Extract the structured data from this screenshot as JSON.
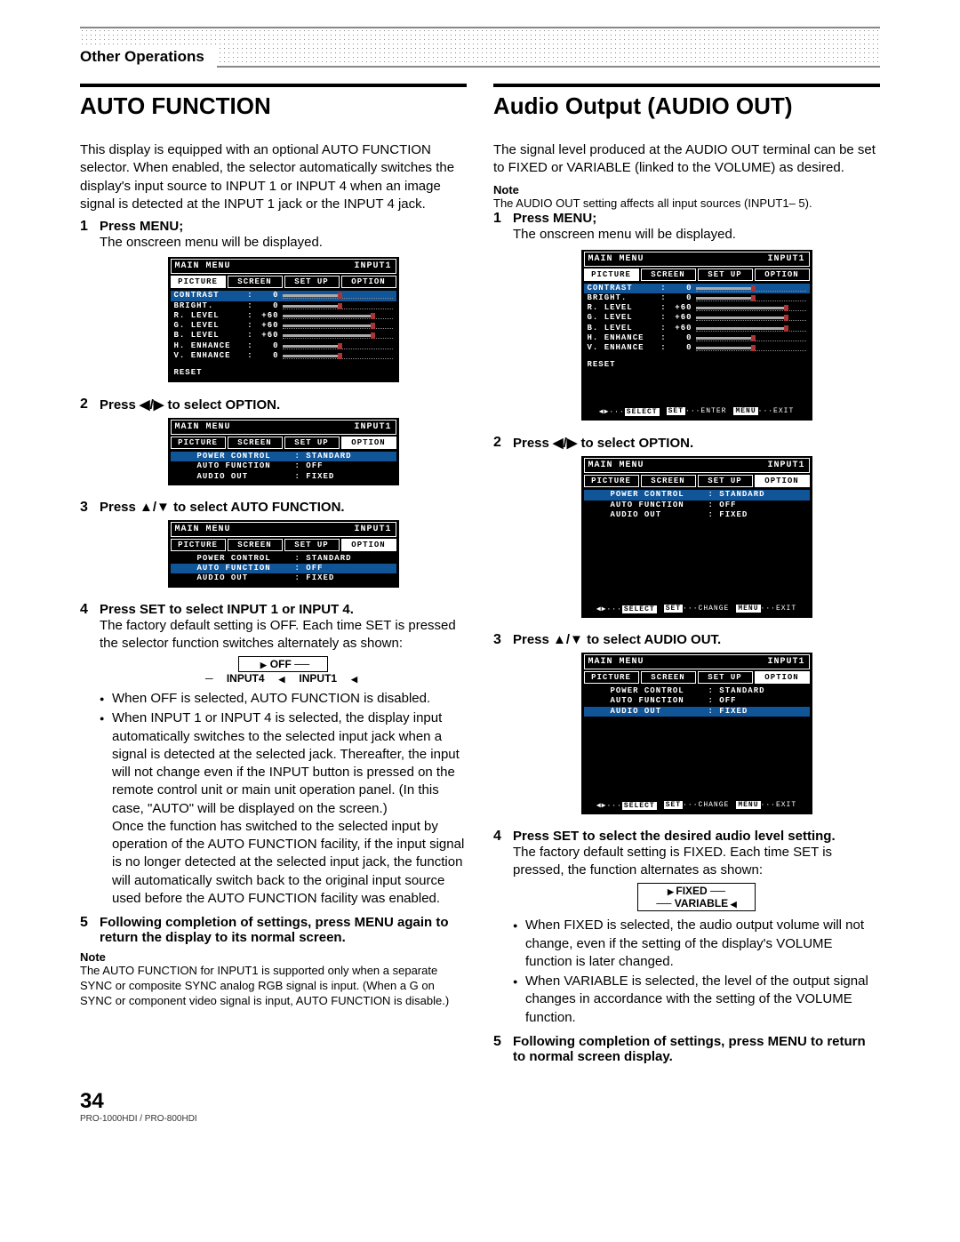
{
  "header": {
    "section": "Other Operations"
  },
  "left": {
    "title": "AUTO FUNCTION",
    "intro": "This display is equipped with an optional AUTO FUNCTION selector. When enabled, the selector automatically switches the display's input source to INPUT 1 or INPUT 4 when an image signal is detected at the INPUT 1 jack or the INPUT 4 jack.",
    "steps": {
      "s1": {
        "n": "1",
        "t": "Press MENU;",
        "d": "The onscreen menu will be displayed."
      },
      "s2": {
        "n": "2",
        "t": "Press ◀/▶ to select OPTION."
      },
      "s3": {
        "n": "3",
        "t": "Press ▲/▼ to select AUTO FUNCTION."
      },
      "s4": {
        "n": "4",
        "t": "Press SET to select INPUT 1 or INPUT 4.",
        "d": "The factory default setting is OFF. Each time SET is pressed the selector function switches alternately as shown:"
      },
      "s5": {
        "n": "5",
        "t": "Following completion of settings, press MENU again to return the display to its normal screen."
      }
    },
    "cycle": {
      "a": "OFF",
      "b": "INPUT4",
      "c": "INPUT1"
    },
    "bullets": {
      "b1": "When OFF is selected, AUTO FUNCTION is disabled.",
      "b2": "When INPUT 1 or INPUT 4 is selected, the display input automatically switches to the selected input jack when a signal is detected at the selected jack. Thereafter, the input will not change even if the INPUT button is pressed on the remote control unit or main unit operation panel. (In this case, \"AUTO\" will be displayed on the screen.)",
      "b2b": "Once the function has switched to the selected input by operation of the AUTO FUNCTION facility, if the input signal is no longer detected at the selected input jack, the function will automatically switch back to the original input source used before the AUTO FUNCTION facility was enabled."
    },
    "note": {
      "h": "Note",
      "b": "The AUTO FUNCTION for INPUT1 is supported only when a separate SYNC or composite SYNC analog RGB signal is input. (When a G on SYNC or component video signal is input, AUTO FUNCTION is disable.)"
    }
  },
  "right": {
    "title": "Audio Output (AUDIO OUT)",
    "intro": "The signal level produced at the AUDIO OUT terminal can be set to FIXED or VARIABLE (linked to the VOLUME) as desired.",
    "noteTop": {
      "h": "Note",
      "b": "The AUDIO OUT setting affects all input sources (INPUT1– 5)."
    },
    "steps": {
      "s1": {
        "n": "1",
        "t": "Press MENU;",
        "d": "The onscreen menu will be displayed."
      },
      "s2": {
        "n": "2",
        "t": "Press ◀/▶ to select OPTION."
      },
      "s3": {
        "n": "3",
        "t": "Press ▲/▼ to select AUDIO OUT."
      },
      "s4": {
        "n": "4",
        "t": "Press SET to select the desired audio level setting.",
        "d": "The factory default setting is FIXED. Each time SET is pressed, the function alternates as shown:"
      },
      "s5": {
        "n": "5",
        "t": "Following completion of settings, press MENU to return to normal screen display."
      }
    },
    "cycle": {
      "a": "FIXED",
      "b": "VARIABLE"
    },
    "bullets": {
      "b1": "When FIXED is selected, the audio output volume will not change, even if the setting of the display's VOLUME function is later changed.",
      "b2": "When VARIABLE is selected, the level of the output signal changes in accordance with the setting of the VOLUME function."
    }
  },
  "osd": {
    "mainmenu": "MAIN MENU",
    "input": "INPUT1",
    "tabs": {
      "picture": "PICTURE",
      "screen": "SCREEN",
      "setup": "SET UP",
      "option": "OPTION"
    },
    "pic": {
      "contrast": "CONTRAST",
      "contrast_v": "0",
      "bright": "BRIGHT.",
      "bright_v": "0",
      "rlevel": "R. LEVEL",
      "rlevel_v": "+60",
      "glevel": "G. LEVEL",
      "glevel_v": "+60",
      "blevel": "B. LEVEL",
      "blevel_v": "+60",
      "henh": "H. ENHANCE",
      "henh_v": "0",
      "venh": "V. ENHANCE",
      "venh_v": "0",
      "reset": "RESET"
    },
    "opt": {
      "power": "POWER CONTROL",
      "power_v": ": STANDARD",
      "auto": "AUTO FUNCTION",
      "auto_v": ": OFF",
      "audio": "AUDIO OUT",
      "audio_v": ": FIXED"
    },
    "foot": {
      "select": "SELECT",
      "enter": "ENTER",
      "change": "CHANGE",
      "set": "SET",
      "menu": "MENU",
      "exit": "EXIT"
    }
  },
  "pagefoot": {
    "num": "34",
    "model": "PRO-1000HDI / PRO-800HDI"
  }
}
